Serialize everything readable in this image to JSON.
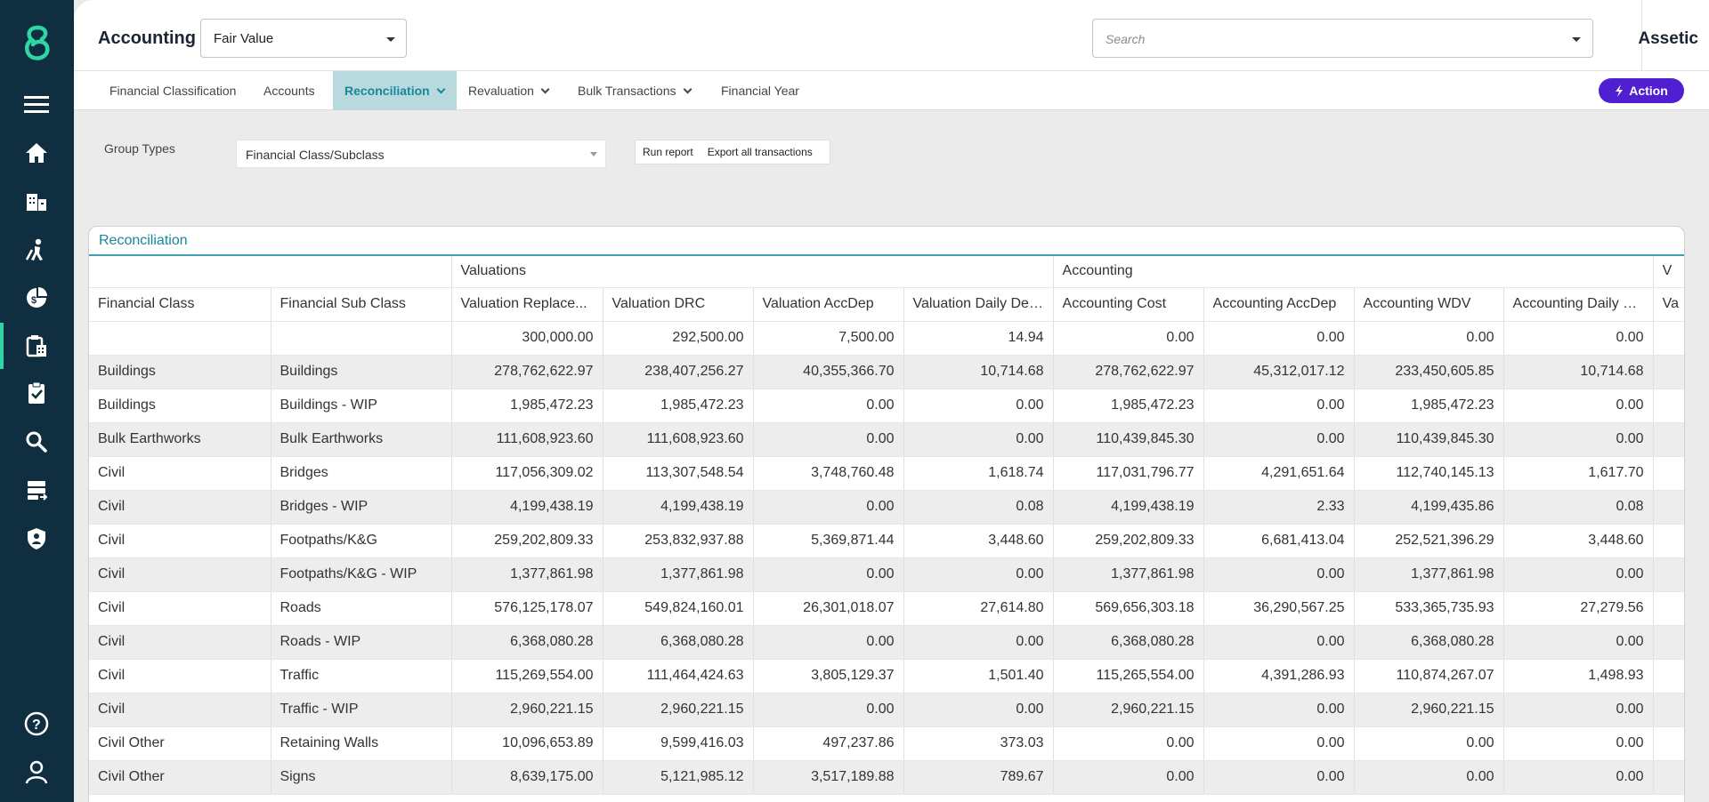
{
  "header": {
    "title": "Accounting",
    "mode_value": "Fair Value",
    "search_placeholder": "Search",
    "brand": "Assetic"
  },
  "tabs": [
    {
      "label": "Financial Classification",
      "active": false,
      "dropdown": false
    },
    {
      "label": "Accounts",
      "active": false,
      "dropdown": false
    },
    {
      "label": "Reconciliation",
      "active": true,
      "dropdown": true
    },
    {
      "label": "Revaluation",
      "active": false,
      "dropdown": true
    },
    {
      "label": "Bulk Transactions",
      "active": false,
      "dropdown": true
    },
    {
      "label": "Financial Year",
      "active": false,
      "dropdown": false
    }
  ],
  "action_label": "Action",
  "filters": {
    "group_types_label": "Group Types",
    "group_types_value": "Financial Class/Subclass",
    "run_report": "Run report",
    "export_all": "Export all transactions"
  },
  "panel": {
    "title": "Reconciliation",
    "groups": [
      "Valuations",
      "Accounting",
      "V"
    ],
    "columns": [
      "Financial Class",
      "Financial Sub Class",
      "Valuation Replace...",
      "Valuation DRC",
      "Valuation AccDep",
      "Valuation Daily Dep...",
      "Accounting Cost",
      "Accounting AccDep",
      "Accounting WDV",
      "Accounting Daily D...",
      "Va"
    ],
    "rows": [
      [
        "",
        "",
        "300,000.00",
        "292,500.00",
        "7,500.00",
        "14.94",
        "0.00",
        "0.00",
        "0.00",
        "0.00",
        ""
      ],
      [
        "Buildings",
        "Buildings",
        "278,762,622.97",
        "238,407,256.27",
        "40,355,366.70",
        "10,714.68",
        "278,762,622.97",
        "45,312,017.12",
        "233,450,605.85",
        "10,714.68",
        ""
      ],
      [
        "Buildings",
        "Buildings - WIP",
        "1,985,472.23",
        "1,985,472.23",
        "0.00",
        "0.00",
        "1,985,472.23",
        "0.00",
        "1,985,472.23",
        "0.00",
        ""
      ],
      [
        "Bulk Earthworks",
        "Bulk Earthworks",
        "111,608,923.60",
        "111,608,923.60",
        "0.00",
        "0.00",
        "110,439,845.30",
        "0.00",
        "110,439,845.30",
        "0.00",
        ""
      ],
      [
        "Civil",
        "Bridges",
        "117,056,309.02",
        "113,307,548.54",
        "3,748,760.48",
        "1,618.74",
        "117,031,796.77",
        "4,291,651.64",
        "112,740,145.13",
        "1,617.70",
        ""
      ],
      [
        "Civil",
        "Bridges - WIP",
        "4,199,438.19",
        "4,199,438.19",
        "0.00",
        "0.08",
        "4,199,438.19",
        "2.33",
        "4,199,435.86",
        "0.08",
        ""
      ],
      [
        "Civil",
        "Footpaths/K&G",
        "259,202,809.33",
        "253,832,937.88",
        "5,369,871.44",
        "3,448.60",
        "259,202,809.33",
        "6,681,413.04",
        "252,521,396.29",
        "3,448.60",
        ""
      ],
      [
        "Civil",
        "Footpaths/K&G - WIP",
        "1,377,861.98",
        "1,377,861.98",
        "0.00",
        "0.00",
        "1,377,861.98",
        "0.00",
        "1,377,861.98",
        "0.00",
        ""
      ],
      [
        "Civil",
        "Roads",
        "576,125,178.07",
        "549,824,160.01",
        "26,301,018.07",
        "27,614.80",
        "569,656,303.18",
        "36,290,567.25",
        "533,365,735.93",
        "27,279.56",
        ""
      ],
      [
        "Civil",
        "Roads - WIP",
        "6,368,080.28",
        "6,368,080.28",
        "0.00",
        "0.00",
        "6,368,080.28",
        "0.00",
        "6,368,080.28",
        "0.00",
        ""
      ],
      [
        "Civil",
        "Traffic",
        "115,269,554.00",
        "111,464,424.63",
        "3,805,129.37",
        "1,501.40",
        "115,265,554.00",
        "4,391,286.93",
        "110,874,267.07",
        "1,498.93",
        ""
      ],
      [
        "Civil",
        "Traffic - WIP",
        "2,960,221.15",
        "2,960,221.15",
        "0.00",
        "0.00",
        "2,960,221.15",
        "0.00",
        "2,960,221.15",
        "0.00",
        ""
      ],
      [
        "Civil Other",
        "Retaining Walls",
        "10,096,653.89",
        "9,599,416.03",
        "497,237.86",
        "373.03",
        "0.00",
        "0.00",
        "0.00",
        "0.00",
        ""
      ],
      [
        "Civil Other",
        "Signs",
        "8,639,175.00",
        "5,121,985.12",
        "3,517,189.88",
        "789.67",
        "0.00",
        "0.00",
        "0.00",
        "0.00",
        ""
      ]
    ]
  }
}
